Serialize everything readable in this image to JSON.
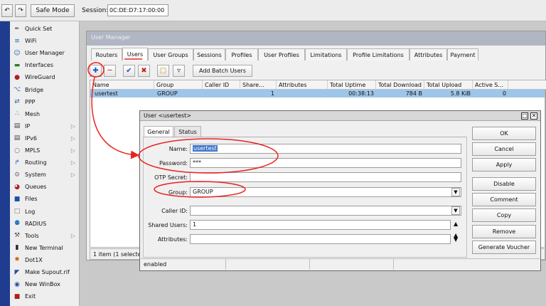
{
  "toolbar": {
    "undo_icon": "undo-icon",
    "redo_icon": "redo-icon",
    "safe_mode": "Safe Mode",
    "session_label": "Session:",
    "session_value": "0C:DE:D7:17:00:00"
  },
  "sidebar": {
    "items": [
      {
        "label": "Quick Set",
        "icon": "wand-icon"
      },
      {
        "label": "WiFi",
        "icon": "wifi-icon"
      },
      {
        "label": "User Manager",
        "icon": "users-icon"
      },
      {
        "label": "Interfaces",
        "icon": "interfaces-icon"
      },
      {
        "label": "WireGuard",
        "icon": "wireguard-icon"
      },
      {
        "label": "Bridge",
        "icon": "bridge-icon"
      },
      {
        "label": "PPP",
        "icon": "ppp-icon"
      },
      {
        "label": "Mesh",
        "icon": "mesh-icon"
      },
      {
        "label": "IP",
        "icon": "ip-icon",
        "submenu": true
      },
      {
        "label": "IPv6",
        "icon": "ipv6-icon",
        "submenu": true
      },
      {
        "label": "MPLS",
        "icon": "mpls-icon",
        "submenu": true
      },
      {
        "label": "Routing",
        "icon": "routing-icon",
        "submenu": true
      },
      {
        "label": "System",
        "icon": "system-icon",
        "submenu": true
      },
      {
        "label": "Queues",
        "icon": "queues-icon"
      },
      {
        "label": "Files",
        "icon": "files-icon"
      },
      {
        "label": "Log",
        "icon": "log-icon"
      },
      {
        "label": "RADIUS",
        "icon": "radius-icon"
      },
      {
        "label": "Tools",
        "icon": "tools-icon",
        "submenu": true
      },
      {
        "label": "New Terminal",
        "icon": "terminal-icon"
      },
      {
        "label": "Dot1X",
        "icon": "dot1x-icon"
      },
      {
        "label": "Make Supout.rif",
        "icon": "supout-icon"
      },
      {
        "label": "New WinBox",
        "icon": "winbox-icon"
      },
      {
        "label": "Exit",
        "icon": "exit-icon"
      }
    ]
  },
  "user_manager": {
    "title": "User Manager",
    "tabs": [
      "Routers",
      "Users",
      "User Groups",
      "Sessions",
      "Profiles",
      "User Profiles",
      "Limitations",
      "Profile Limitations",
      "Attributes",
      "Payment"
    ],
    "active_tab": "Users",
    "add_batch_users": "Add Batch Users",
    "columns": [
      "Name",
      "Group",
      "Caller ID",
      "Share...",
      "Attributes",
      "Total Uptime",
      "Total Download",
      "Total Upload",
      "Active S..."
    ],
    "rows": [
      {
        "name": "usertest",
        "group": "GROUP",
        "caller_id": "",
        "shared": "1",
        "attributes": "",
        "uptime": "00:38:13",
        "download": "784 B",
        "upload": "5.8 KiB",
        "active": "0"
      }
    ],
    "status": "1 item (1 selecte"
  },
  "dialog": {
    "title": "User <usertest>",
    "tabs": [
      "General",
      "Status"
    ],
    "fields": {
      "name_label": "Name:",
      "name_value": "usertest",
      "password_label": "Password:",
      "password_value": "***",
      "otp_label": "OTP Secret:",
      "otp_value": "",
      "group_label": "Group:",
      "group_value": "GROUP",
      "caller_id_label": "Caller ID:",
      "caller_id_value": "",
      "shared_users_label": "Shared Users:",
      "shared_users_value": "1",
      "attributes_label": "Attributes:",
      "attributes_value": ""
    },
    "buttons": [
      "OK",
      "Cancel",
      "Apply",
      "Disable",
      "Comment",
      "Copy",
      "Remove",
      "Generate Voucher"
    ],
    "status": "enabled"
  },
  "colors": {
    "annotation": "#e8231e",
    "selection": "#9ec5ea",
    "side_strip": "#1f3c8e"
  }
}
